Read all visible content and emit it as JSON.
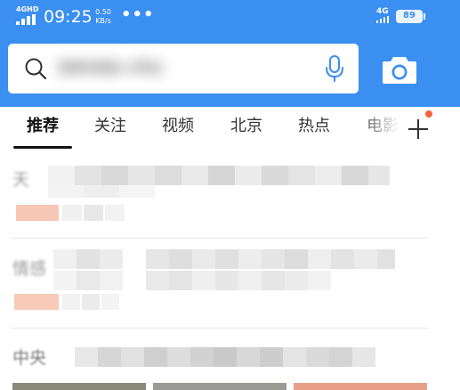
{
  "status_bar": {
    "network_label": "4GHD",
    "time": "09:25",
    "net_speed_value": "0.50",
    "net_speed_unit": "KB/s",
    "more_indicator": "•••",
    "network_right_label": "4G",
    "battery_level": "89"
  },
  "search": {
    "placeholder": "搜索或输入网址",
    "search_icon": "search-icon",
    "voice_icon": "microphone-icon",
    "camera_icon": "camera-icon"
  },
  "tabs": {
    "items": [
      {
        "label": "推荐",
        "active": true
      },
      {
        "label": "关注",
        "active": false
      },
      {
        "label": "视频",
        "active": false
      },
      {
        "label": "北京",
        "active": false
      },
      {
        "label": "热点",
        "active": false
      },
      {
        "label": "电影",
        "active": false
      }
    ],
    "add_button_icon": "plus-icon"
  },
  "feed": {
    "items": [
      {
        "title_prefix": "天"
      },
      {
        "title_prefix": "情感"
      },
      {
        "title_prefix": "中央"
      }
    ]
  },
  "colors": {
    "header_blue": "#3a8ff0",
    "accent_orange": "#f0643a"
  }
}
